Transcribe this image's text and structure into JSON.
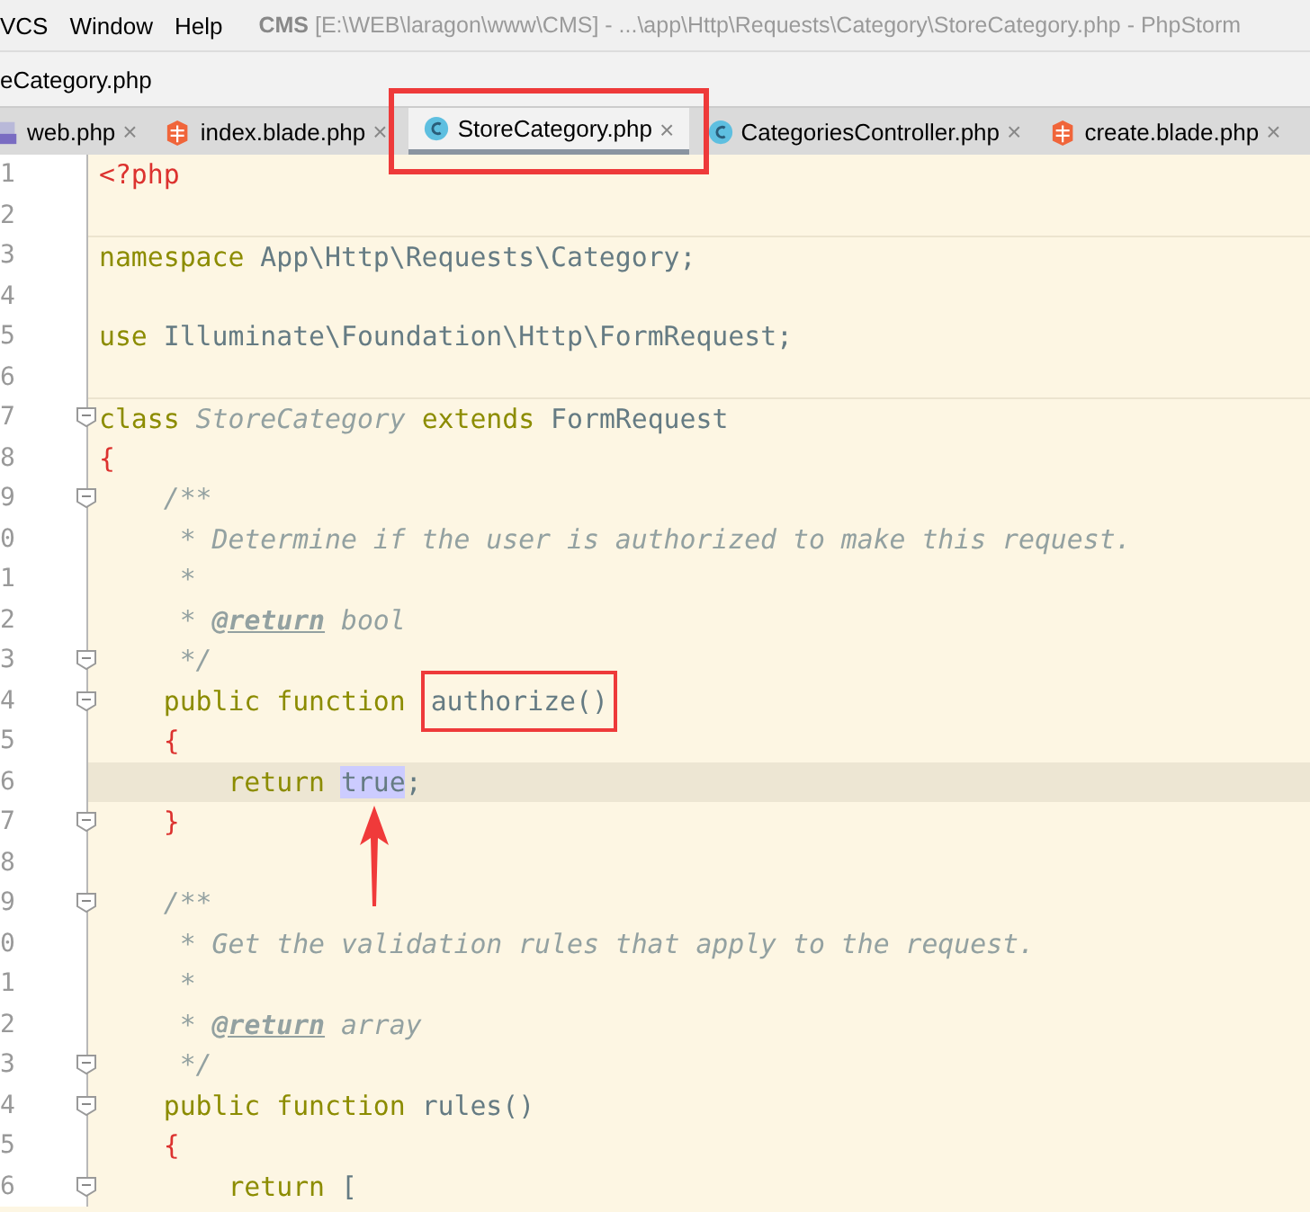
{
  "menu": [
    "VCS",
    "Window",
    "Help"
  ],
  "window": {
    "title": "**CMS** [E:\\WEB\\laragon\\www\\CMS] - ...\\app\\Http\\Requests\\Category\\StoreCategory.php - PhpStorm"
  },
  "breadcrumb": "eCategory.php",
  "tabs": [
    {
      "label": "web.php",
      "kind": "php",
      "selected": false,
      "annotated": false
    },
    {
      "label": "index.blade.php",
      "kind": "blade",
      "selected": false,
      "annotated": false
    },
    {
      "label": "StoreCategory.php",
      "kind": "class",
      "selected": true,
      "annotated": true
    },
    {
      "label": "CategoriesController.php",
      "kind": "class",
      "selected": false,
      "annotated": false
    },
    {
      "label": "create.blade.php",
      "kind": "blade",
      "selected": false,
      "annotated": false
    }
  ],
  "tab_close": "×",
  "lines": [
    {
      "number": "1",
      "fold": false,
      "current": false,
      "separator": false,
      "tokens": [
        {
          "kind": "phptag",
          "text": "<?php"
        }
      ]
    },
    {
      "number": "2",
      "fold": false,
      "current": false,
      "separator": false
    },
    {
      "number": "3",
      "fold": false,
      "current": false,
      "separator": true,
      "tokens": [
        {
          "kind": "kw",
          "text": "namespace "
        },
        {
          "kind": "name",
          "text": "App\\Http\\Requests\\Category;"
        }
      ]
    },
    {
      "number": "4",
      "fold": false,
      "current": false,
      "separator": false
    },
    {
      "number": "5",
      "fold": false,
      "current": false,
      "separator": false,
      "tokens": [
        {
          "kind": "kw",
          "text": "use "
        },
        {
          "kind": "name",
          "text": "Illuminate\\Foundation\\Http\\FormRequest;"
        }
      ]
    },
    {
      "number": "6",
      "fold": false,
      "current": false,
      "separator": false
    },
    {
      "number": "7",
      "fold": true,
      "current": false,
      "separator": true,
      "tokens": [
        {
          "kind": "kw",
          "text": "class "
        },
        {
          "kind": "classname",
          "text": "StoreCategory "
        },
        {
          "kind": "kw",
          "text": "extends "
        },
        {
          "kind": "name",
          "text": "FormRequest"
        }
      ]
    },
    {
      "number": "8",
      "fold": false,
      "current": false,
      "tokens": [
        {
          "kind": "brace",
          "text": "{"
        }
      ]
    },
    {
      "number": "9",
      "fold": true,
      "current": false,
      "tokens": [
        {
          "kind": "comment",
          "text": "    /**"
        }
      ]
    },
    {
      "number": "0",
      "fold": false,
      "current": false,
      "tokens": [
        {
          "kind": "comment",
          "text": "     * Determine if the user is authorized to make this request."
        }
      ]
    },
    {
      "number": "1",
      "fold": false,
      "current": false,
      "tokens": [
        {
          "kind": "comment",
          "text": "     *"
        }
      ]
    },
    {
      "number": "2",
      "fold": false,
      "current": false,
      "tokens": [
        {
          "kind": "comment",
          "text": "     * "
        },
        {
          "kind": "doctag",
          "text": "@return"
        },
        {
          "kind": "comment",
          "text": " bool"
        }
      ]
    },
    {
      "number": "3",
      "fold": true,
      "current": false,
      "tokens": [
        {
          "kind": "comment",
          "text": "     */"
        }
      ]
    },
    {
      "number": "4",
      "fold": true,
      "current": false,
      "tokens": [
        {
          "kind": "kw",
          "text": "    public function "
        },
        {
          "kind": "name",
          "text": "authorize()",
          "annotated": true
        }
      ]
    },
    {
      "number": "5",
      "fold": false,
      "current": false,
      "tokens": [
        {
          "kind": "brace",
          "text": "    {"
        }
      ]
    },
    {
      "number": "6",
      "fold": false,
      "current": true,
      "tokens": [
        {
          "kind": "kw",
          "text": "        return "
        },
        {
          "kind": "name",
          "text": "true",
          "highlighted": true,
          "arrow": true
        },
        {
          "kind": "name",
          "text": ";"
        }
      ]
    },
    {
      "number": "7",
      "fold": true,
      "current": false,
      "tokens": [
        {
          "kind": "brace",
          "text": "    }"
        }
      ]
    },
    {
      "number": "8",
      "fold": false,
      "current": false,
      "separator": false
    },
    {
      "number": "9",
      "fold": true,
      "current": false,
      "tokens": [
        {
          "kind": "comment",
          "text": "    /**"
        }
      ]
    },
    {
      "number": "0",
      "fold": false,
      "current": false,
      "tokens": [
        {
          "kind": "comment",
          "text": "     * Get the validation rules that apply to the request."
        }
      ]
    },
    {
      "number": "1",
      "fold": false,
      "current": false,
      "tokens": [
        {
          "kind": "comment",
          "text": "     *"
        }
      ]
    },
    {
      "number": "2",
      "fold": false,
      "current": false,
      "tokens": [
        {
          "kind": "comment",
          "text": "     * "
        },
        {
          "kind": "doctag",
          "text": "@return"
        },
        {
          "kind": "comment",
          "text": " array"
        }
      ]
    },
    {
      "number": "3",
      "fold": true,
      "current": false,
      "tokens": [
        {
          "kind": "comment",
          "text": "     */"
        }
      ]
    },
    {
      "number": "4",
      "fold": true,
      "current": false,
      "tokens": [
        {
          "kind": "kw",
          "text": "    public function "
        },
        {
          "kind": "name",
          "text": "rules()"
        }
      ]
    },
    {
      "number": "5",
      "fold": false,
      "current": false,
      "tokens": [
        {
          "kind": "brace",
          "text": "    {"
        }
      ]
    },
    {
      "number": "6",
      "fold": true,
      "current": false,
      "tokens": [
        {
          "kind": "kw",
          "text": "        return "
        },
        {
          "kind": "name",
          "text": "["
        }
      ]
    }
  ]
}
